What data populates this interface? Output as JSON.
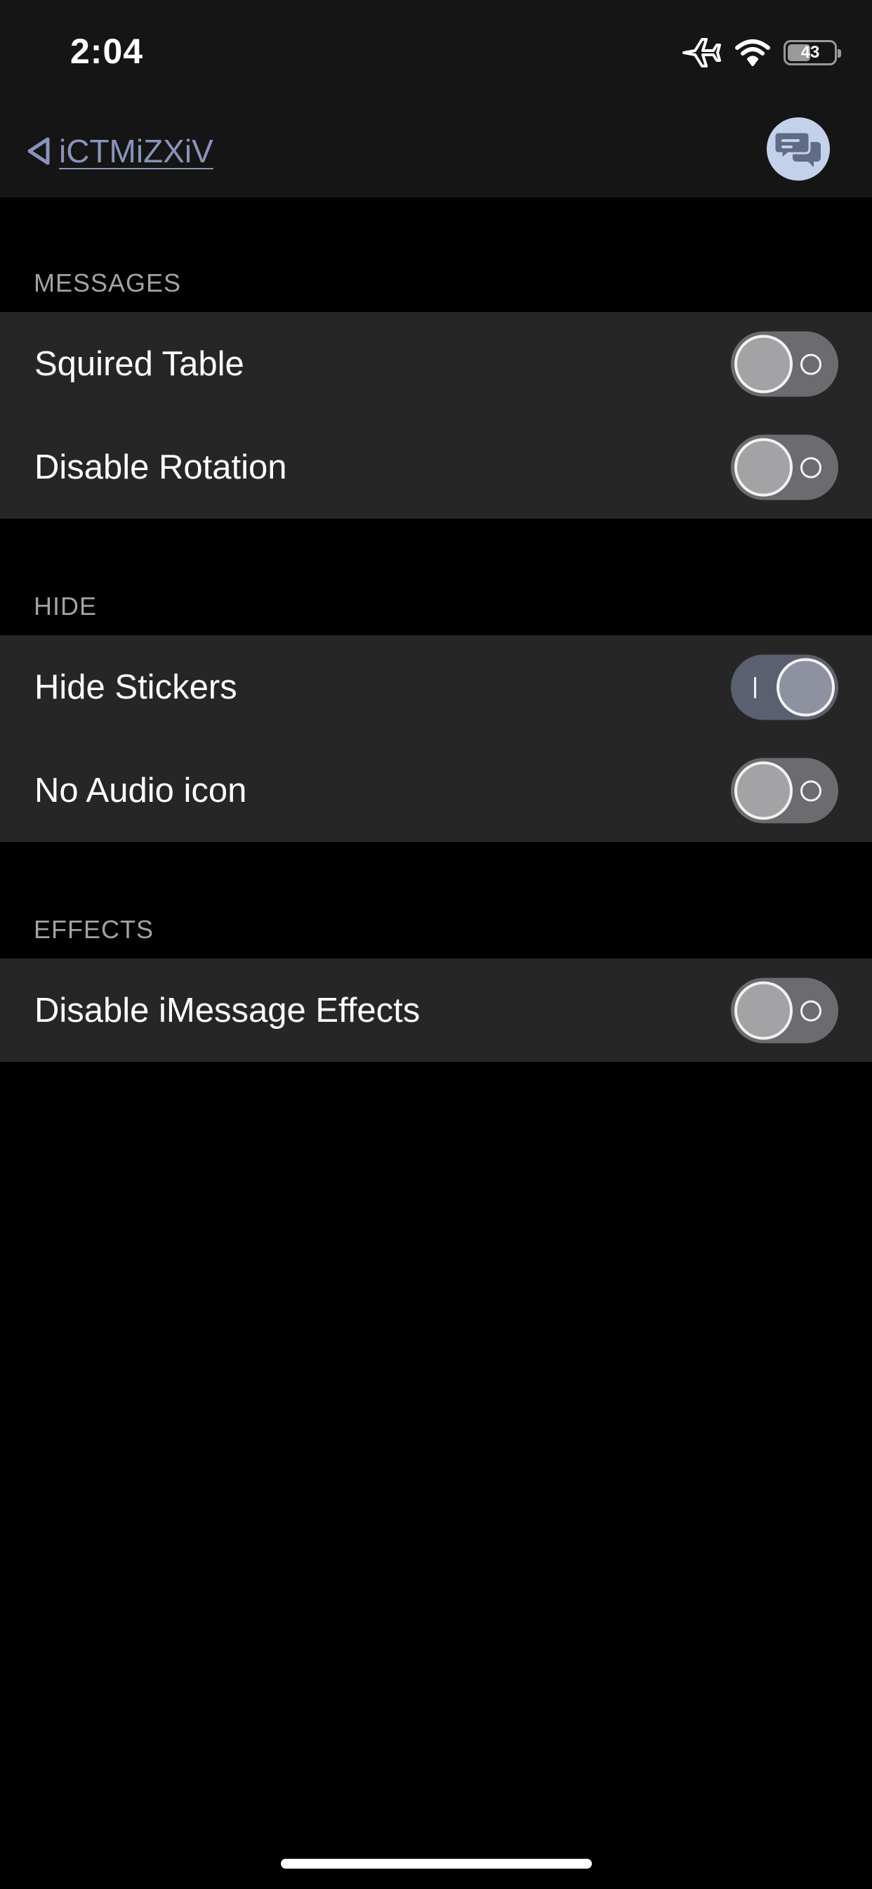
{
  "status_bar": {
    "time": "2:04",
    "battery_level": "43",
    "icons": [
      "airplane-icon",
      "wifi-icon",
      "battery-icon"
    ]
  },
  "nav": {
    "back_label": "iCTMiZXiV",
    "right_icon": "chat-bubbles-icon"
  },
  "sections": [
    {
      "header": "MESSAGES",
      "items": [
        {
          "label": "Squired Table",
          "on": false
        },
        {
          "label": "Disable Rotation",
          "on": false
        }
      ]
    },
    {
      "header": "HIDE",
      "items": [
        {
          "label": "Hide Stickers",
          "on": true
        },
        {
          "label": "No Audio icon",
          "on": false
        }
      ]
    },
    {
      "header": "EFFECTS",
      "items": [
        {
          "label": "Disable iMessage Effects",
          "on": false
        }
      ]
    }
  ],
  "colors": {
    "background": "#000000",
    "bar": "#151515",
    "cell": "#262627",
    "accent_link": "#8a93b8",
    "toggle_off": "#6b6b70",
    "toggle_on": "#5b6070"
  }
}
